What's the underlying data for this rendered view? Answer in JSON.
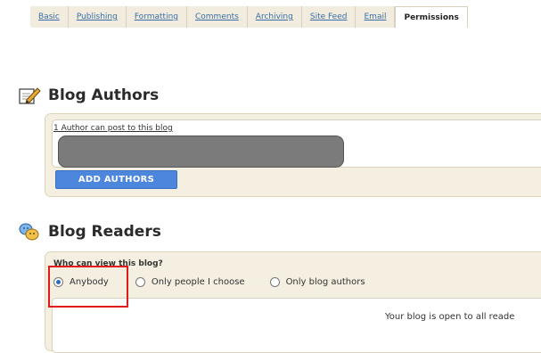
{
  "tabs": [
    {
      "label": "Basic",
      "active": false
    },
    {
      "label": "Publishing",
      "active": false
    },
    {
      "label": "Formatting",
      "active": false
    },
    {
      "label": "Comments",
      "active": false
    },
    {
      "label": "Archiving",
      "active": false
    },
    {
      "label": "Site Feed",
      "active": false
    },
    {
      "label": "Email",
      "active": false
    },
    {
      "label": "Permissions",
      "active": true
    }
  ],
  "authors": {
    "title": "Blog Authors",
    "icon": "edit-pencil-icon",
    "count_text": "1 Author can post to this blog",
    "add_button_label": "ADD AUTHORS"
  },
  "readers": {
    "title": "Blog Readers",
    "icon": "readers-people-icon",
    "question": "Who can view this blog?",
    "options": [
      {
        "label": "Anybody",
        "checked": true
      },
      {
        "label": "Only people I choose",
        "checked": false
      },
      {
        "label": "Only blog authors",
        "checked": false
      }
    ],
    "status_text": "Your blog is open to all reade"
  },
  "colors": {
    "accent_button": "#4d86dd",
    "highlight_box": "#e01b1b",
    "panel_bg": "#f4efe0"
  }
}
